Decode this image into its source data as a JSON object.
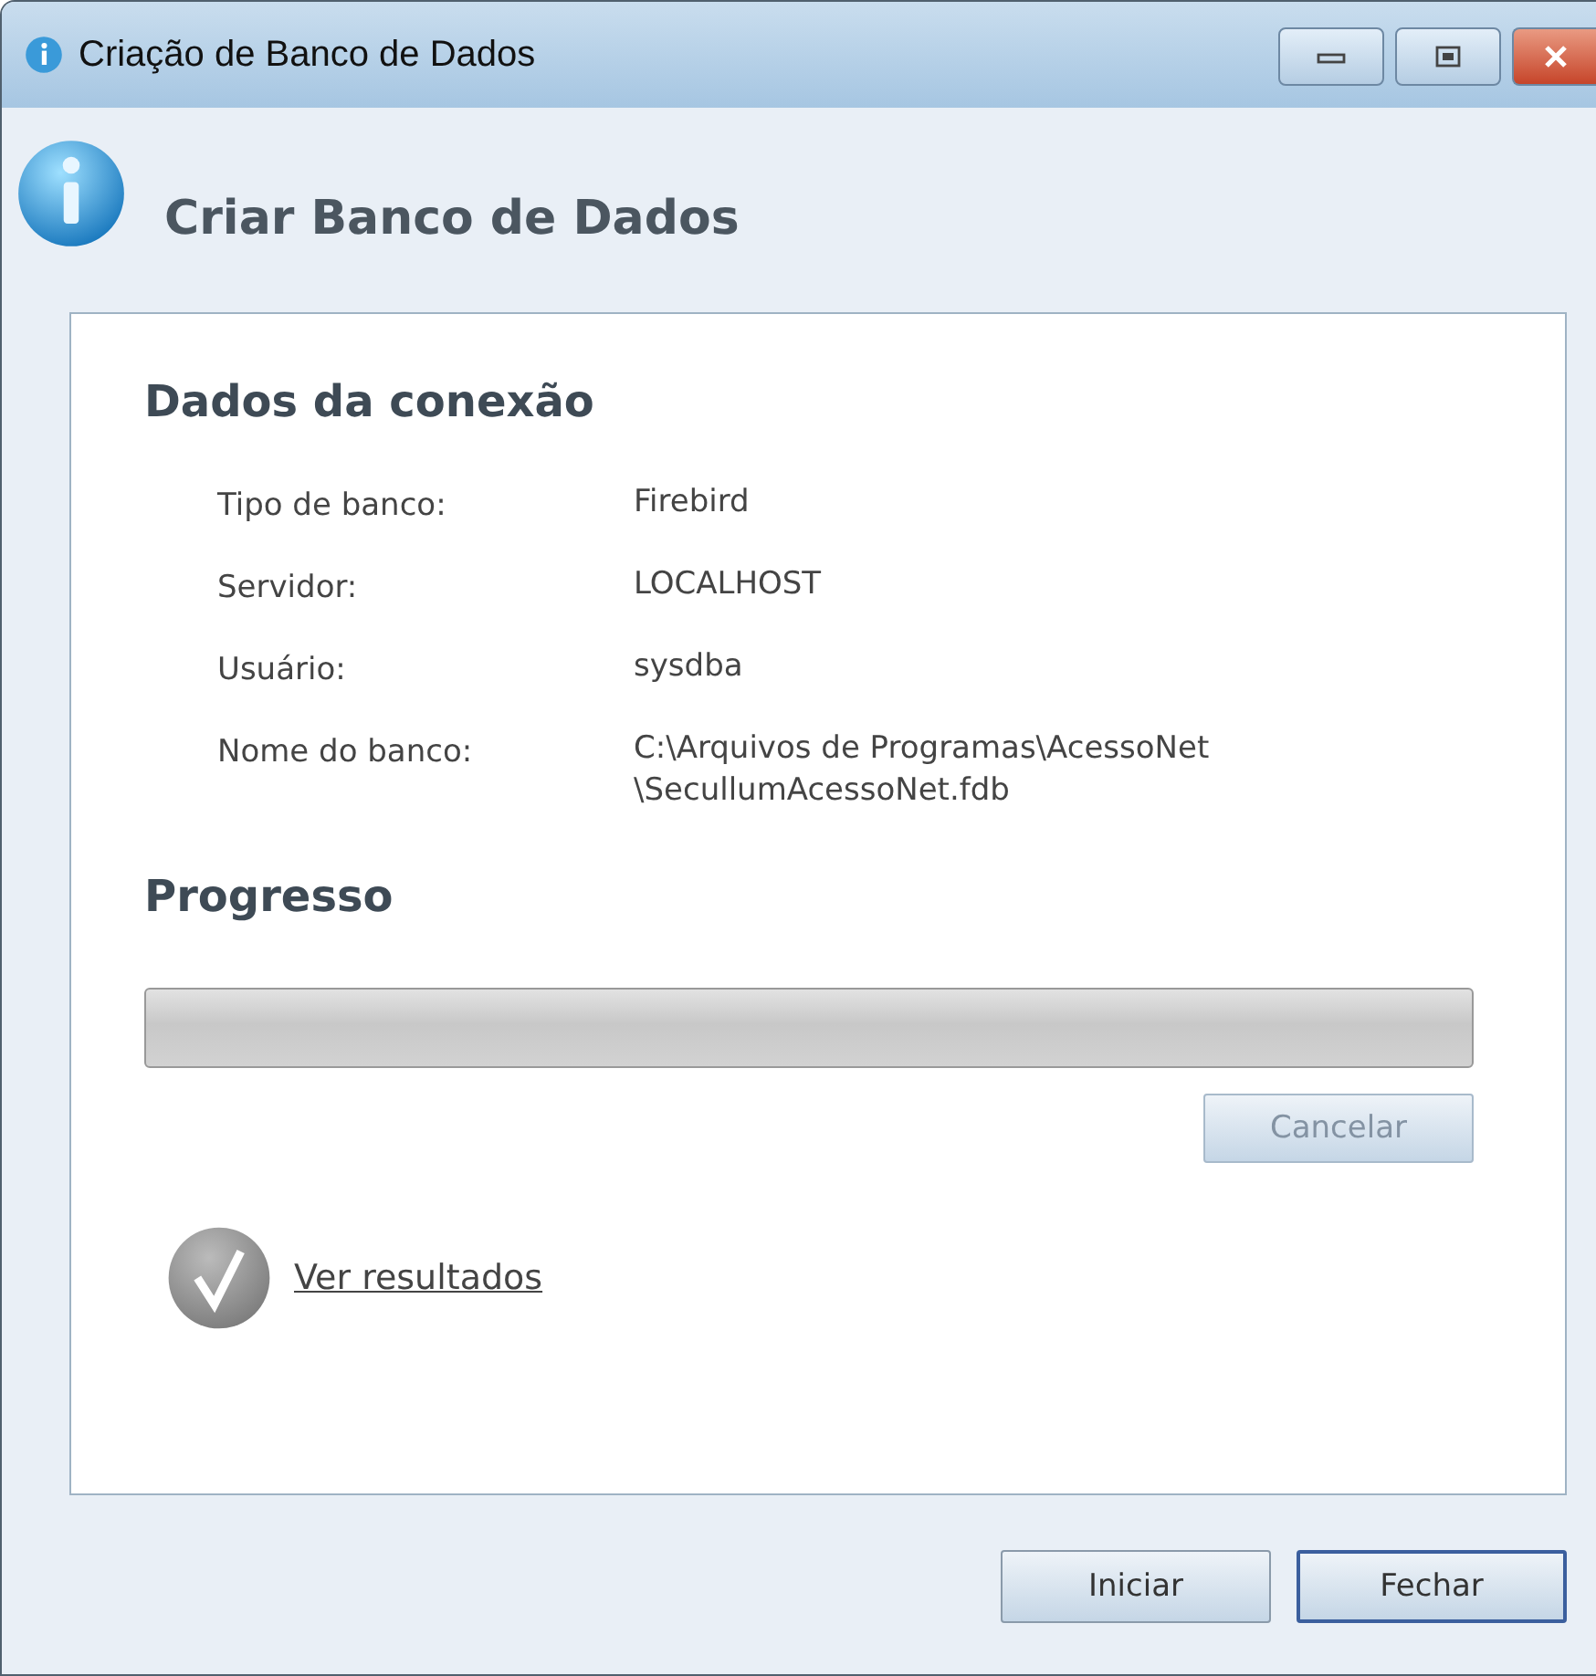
{
  "window": {
    "title": "Criação de Banco de Dados"
  },
  "header": {
    "title": "Criar Banco de Dados"
  },
  "connection": {
    "heading": "Dados da conexão",
    "fields": [
      {
        "label": "Tipo de banco:",
        "value": "Firebird"
      },
      {
        "label": "Servidor:",
        "value": "LOCALHOST"
      },
      {
        "label": "Usuário:",
        "value": "sysdba"
      },
      {
        "label": "Nome do banco:",
        "value": "C:\\Arquivos de Programas\\AcessoNet \\SecullumAcessoNet.fdb"
      }
    ]
  },
  "progress": {
    "heading": "Progresso",
    "level": 0,
    "cancel": {
      "label": "Cancelar",
      "disabled": true
    }
  },
  "results_link": "Ver resultados",
  "buttons": [
    {
      "label": "Iniciar",
      "focused": false
    },
    {
      "label": "Fechar",
      "focused": true
    }
  ]
}
